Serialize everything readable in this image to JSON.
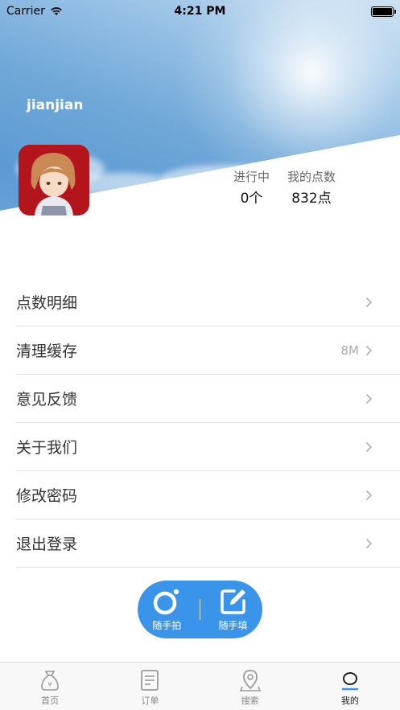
{
  "status_bar": {
    "carrier": "Carrier",
    "time": "4:21 PM"
  },
  "profile": {
    "username": "jianjian",
    "stats": [
      {
        "label": "进行中",
        "value": "0个"
      },
      {
        "label": "我的点数",
        "value": "832点"
      }
    ]
  },
  "menu": {
    "items": [
      {
        "label": "点数明细",
        "detail": ""
      },
      {
        "label": "清理缓存",
        "detail": "8M"
      },
      {
        "label": "意见反馈",
        "detail": ""
      },
      {
        "label": "关于我们",
        "detail": ""
      },
      {
        "label": "修改密码",
        "detail": ""
      },
      {
        "label": "退出登录",
        "detail": ""
      }
    ]
  },
  "fab": {
    "photo_label": "随手拍",
    "fill_label": "随手填",
    "color": "#3a95ea"
  },
  "tabbar": {
    "tabs": [
      {
        "label": "首页",
        "icon": "money-bag-icon"
      },
      {
        "label": "订单",
        "icon": "document-icon"
      },
      {
        "label": "搜索",
        "icon": "location-pin-icon"
      },
      {
        "label": "我的",
        "icon": "profile-icon",
        "active": true
      }
    ]
  }
}
